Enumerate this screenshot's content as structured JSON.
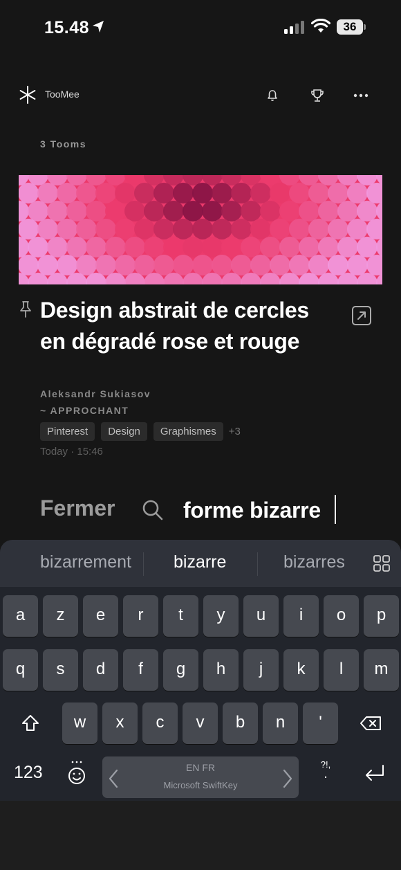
{
  "status_bar": {
    "time": "15.48",
    "battery": "36"
  },
  "header": {
    "app_name": "TooMee"
  },
  "feed": {
    "count_label": "3 Tooms"
  },
  "card": {
    "title": "Design abstrait de cercles en dégradé rose et rouge",
    "author": "Aleksandr Sukiasov",
    "collection": "~ APPROCHANT",
    "tags": [
      "Pinterest",
      "Design",
      "Graphismes"
    ],
    "tags_more": "+3",
    "timestamp": "Today · 15:46",
    "banner_colors": {
      "light": "#f19ae0",
      "mid": "#ec3a6c",
      "dark": "#6b0a3a"
    }
  },
  "search": {
    "close_label": "Fermer",
    "value": "forme bizarre"
  },
  "keyboard": {
    "suggestions": [
      "bizarrement",
      "bizarre",
      "bizarres"
    ],
    "row1": [
      "a",
      "z",
      "e",
      "r",
      "t",
      "y",
      "u",
      "i",
      "o",
      "p"
    ],
    "row2": [
      "q",
      "s",
      "d",
      "f",
      "g",
      "h",
      "j",
      "k",
      "l",
      "m"
    ],
    "row3": [
      "w",
      "x",
      "c",
      "v",
      "b",
      "n",
      "'"
    ],
    "numbers_label": "123",
    "space_language": "EN FR",
    "space_brand": "Microsoft SwiftKey",
    "punct_label": "?!,"
  }
}
